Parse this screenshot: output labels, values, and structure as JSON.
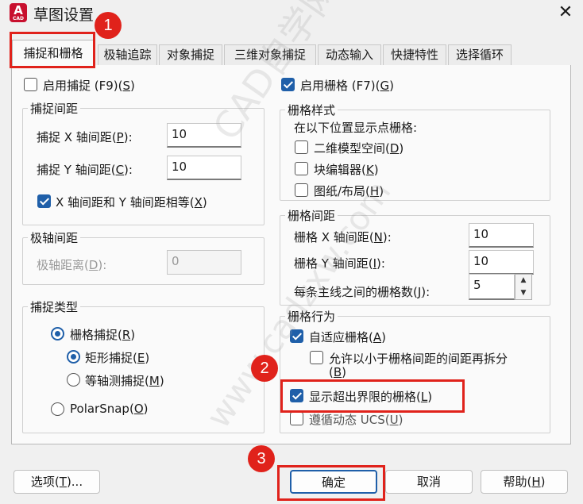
{
  "window": {
    "app_icon_letter": "A",
    "app_icon_caption": "CAD",
    "title": "草图设置",
    "close_glyph": "✕"
  },
  "tabs": [
    {
      "label": "捕捉和栅格"
    },
    {
      "label": "极轴追踪"
    },
    {
      "label": "对象捕捉"
    },
    {
      "label": "三维对象捕捉"
    },
    {
      "label": "动态输入"
    },
    {
      "label": "快捷特性"
    },
    {
      "label": "选择循环"
    }
  ],
  "snap": {
    "enable": {
      "text": "启用捕捉 (F9)(",
      "key": "S",
      "suffix": ")",
      "checked": false
    },
    "spacing_group": "捕捉间距",
    "x_label": {
      "text": "捕捉 X 轴间距(",
      "key": "P",
      "suffix": "):"
    },
    "x_value": "10",
    "y_label": {
      "text": "捕捉 Y 轴间距(",
      "key": "C",
      "suffix": "):"
    },
    "y_value": "10",
    "equal": {
      "text": "X 轴间距和 Y 轴间距相等(",
      "key": "X",
      "suffix": ")",
      "checked": true
    },
    "polar_group": "极轴间距",
    "polar_label": {
      "text": "极轴距离(",
      "key": "D",
      "suffix": "):"
    },
    "polar_value": "0",
    "type_group": "捕捉类型",
    "grid_snap": {
      "text": "栅格捕捉(",
      "key": "R",
      "suffix": ")",
      "checked": true
    },
    "rect_snap": {
      "text": "矩形捕捉(",
      "key": "E",
      "suffix": ")",
      "checked": true
    },
    "iso_snap": {
      "text": "等轴测捕捉(",
      "key": "M",
      "suffix": ")",
      "checked": false
    },
    "polarsnap": {
      "text": "PolarSnap(",
      "key": "O",
      "suffix": ")",
      "checked": false
    }
  },
  "grid": {
    "enable": {
      "text": "启用栅格 (F7)(",
      "key": "G",
      "suffix": ")",
      "checked": true
    },
    "style_group": "栅格样式",
    "style_desc": "在以下位置显示点栅格:",
    "model_space": {
      "text": "二维模型空间(",
      "key": "D",
      "suffix": ")",
      "checked": false
    },
    "block_editor": {
      "text": "块编辑器(",
      "key": "K",
      "suffix": ")",
      "checked": false
    },
    "sheet_layout": {
      "text": "图纸/布局(",
      "key": "H",
      "suffix": ")",
      "checked": false
    },
    "spacing_group": "栅格间距",
    "x_label": {
      "text": "栅格 X 轴间距(",
      "key": "N",
      "suffix": "):"
    },
    "x_value": "10",
    "y_label": {
      "text": "栅格 Y 轴间距(",
      "key": "I",
      "suffix": "):"
    },
    "y_value": "10",
    "major_label": {
      "text": "每条主线之间的栅格数(",
      "key": "J",
      "suffix": "):"
    },
    "major_value": "5",
    "behavior_group": "栅格行为",
    "adaptive": {
      "text": "自适应栅格(",
      "key": "A",
      "suffix": ")",
      "checked": true
    },
    "subdivide": {
      "text": "允许以小于栅格间距的间距再拆分",
      "text2": "(",
      "key": "B",
      "suffix": ")",
      "checked": false
    },
    "beyond_limits": {
      "text": "显示超出界限的栅格(",
      "key": "L",
      "suffix": ")",
      "checked": true
    },
    "follow_ucs": {
      "text": "遵循动态 UCS(",
      "key": "U",
      "suffix": ")",
      "checked": false
    }
  },
  "footer": {
    "options": {
      "text": "选项(",
      "key": "T",
      "suffix": ")..."
    },
    "ok": "确定",
    "cancel": "取消",
    "help": {
      "text": "帮助(",
      "key": "H",
      "suffix": ")"
    }
  },
  "callouts": [
    "1",
    "2",
    "3"
  ],
  "watermark": [
    "CAD自学网",
    "www.cadzxw.com"
  ],
  "colors": {
    "accent": "#1f5fa9",
    "callout": "#e0221b"
  }
}
